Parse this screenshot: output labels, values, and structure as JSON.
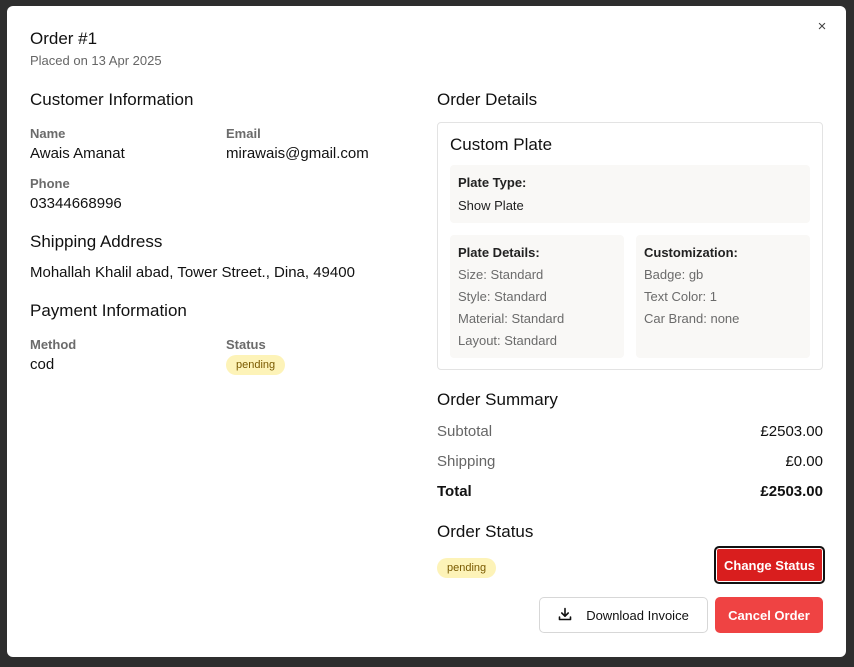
{
  "modal": {
    "title": "Order #1",
    "subtitle": "Placed on 13 Apr 2025",
    "close_icon": "×"
  },
  "customer": {
    "heading": "Customer Information",
    "name_label": "Name",
    "name_value": "Awais Amanat",
    "email_label": "Email",
    "email_value": "mirawais@gmail.com",
    "phone_label": "Phone",
    "phone_value": "03344668996"
  },
  "shipping": {
    "heading": "Shipping Address",
    "address": "Mohallah Khalil abad, Tower Street., Dina, 49400"
  },
  "payment": {
    "heading": "Payment Information",
    "method_label": "Method",
    "method_value": "cod",
    "status_label": "Status",
    "status_value": "pending"
  },
  "order_details": {
    "heading": "Order Details",
    "card_title": "Custom Plate",
    "plate_type_label": "Plate Type:",
    "plate_type_value": "Show Plate",
    "plate_details_label": "Plate Details:",
    "plate_details": [
      "Size: Standard",
      "Style: Standard",
      "Material: Standard",
      "Layout: Standard"
    ],
    "customization_label": "Customization:",
    "customization": [
      "Badge: gb",
      "Text Color: 1",
      "Car Brand: none"
    ]
  },
  "summary": {
    "heading": "Order Summary",
    "subtotal_label": "Subtotal",
    "subtotal_value": "£2503.00",
    "shipping_label": "Shipping",
    "shipping_value": "£0.00",
    "total_label": "Total",
    "total_value": "£2503.00"
  },
  "status": {
    "heading": "Order Status",
    "value": "pending",
    "change_button": "Change Status"
  },
  "actions": {
    "download_label": "Download Invoice",
    "download_icon": "download-icon",
    "cancel_label": "Cancel Order"
  },
  "colors": {
    "accent_red": "#d91e1e",
    "cancel_red": "#ef4343",
    "badge_bg": "#fdf3b8"
  }
}
